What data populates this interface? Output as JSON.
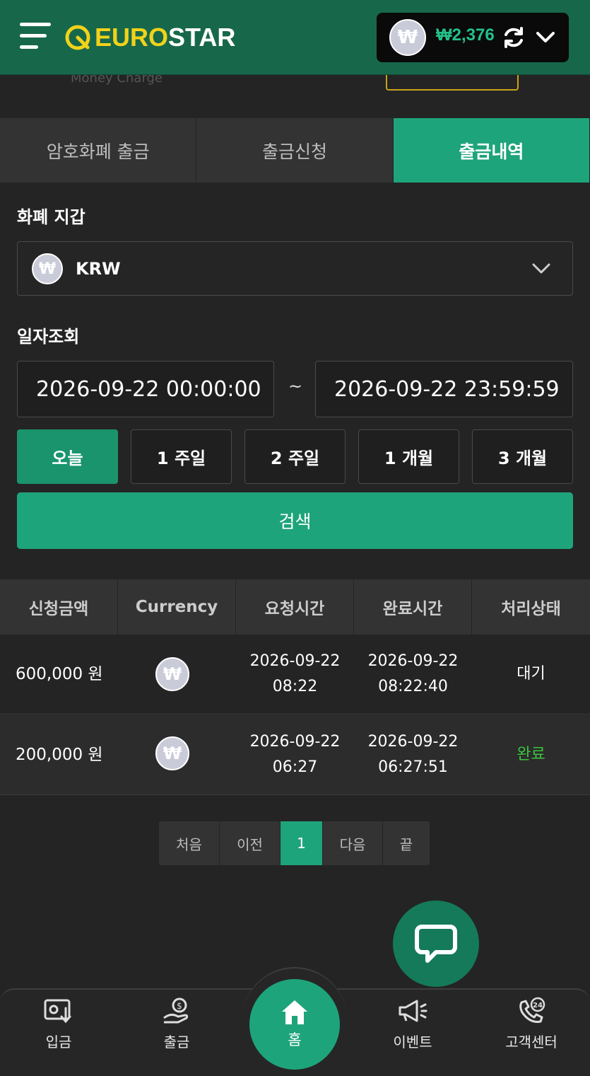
{
  "header": {
    "logo_part1": "EURO",
    "logo_part2": "STAR",
    "balance": "₩2,376",
    "currency_symbol": "₩"
  },
  "peek": {
    "subtitle": "Money Charge"
  },
  "tabs": [
    {
      "label": "암호화폐 출금",
      "active": false
    },
    {
      "label": "출금신청",
      "active": false
    },
    {
      "label": "출금내역",
      "active": true
    }
  ],
  "wallet": {
    "label": "화폐 지갑",
    "selected": "KRW"
  },
  "date_query": {
    "label": "일자조회",
    "start": "2026-09-22 00:00:00",
    "separator": "~",
    "end": "2026-09-22 23:59:59"
  },
  "periods": [
    {
      "label": "오늘",
      "active": true
    },
    {
      "label": "1 주일",
      "active": false
    },
    {
      "label": "2 주일",
      "active": false
    },
    {
      "label": "1 개월",
      "active": false
    },
    {
      "label": "3 개월",
      "active": false
    }
  ],
  "search_label": "검색",
  "table": {
    "headers": [
      "신청금액",
      "Currency",
      "요청시간",
      "완료시간",
      "처리상태"
    ],
    "rows": [
      {
        "amount": "600,000 원",
        "req_date": "2026-09-22",
        "req_time": "08:22",
        "done_date": "2026-09-22",
        "done_time": "08:22:40",
        "status": "대기",
        "status_color": "#ffffff"
      },
      {
        "amount": "200,000 원",
        "req_date": "2026-09-22",
        "req_time": "06:27",
        "done_date": "2026-09-22",
        "done_time": "06:27:51",
        "status": "완료",
        "status_color": "#3cc43c"
      }
    ]
  },
  "pagination": [
    "처음",
    "이전",
    "1",
    "다음",
    "끝"
  ],
  "bottom_nav": {
    "deposit": "입금",
    "withdraw": "출금",
    "home": "홈",
    "event": "이벤트",
    "support": "고객센터",
    "support_badge": "24"
  },
  "colors": {
    "brand_green": "#1ea47a",
    "header_green": "#17684a",
    "logo_yellow": "#f2d21a"
  }
}
